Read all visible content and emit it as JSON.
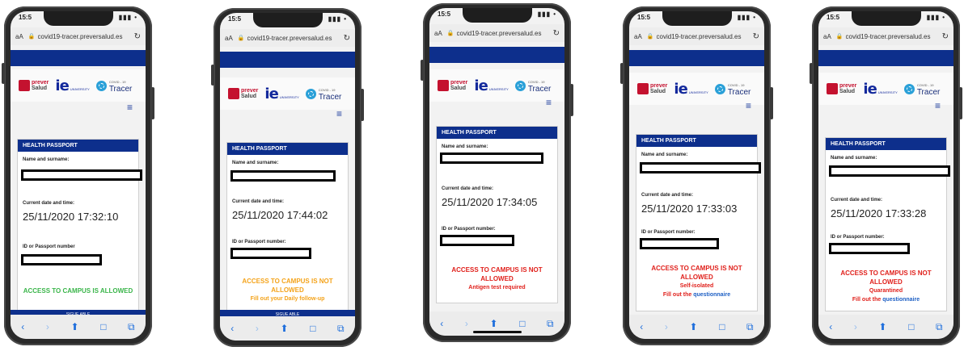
{
  "common": {
    "time_partial": "15:5",
    "signal": "▮▮▮ •",
    "aa_label": "aA",
    "lock": "🔒",
    "url": "covid19-tracer.preversalud.es",
    "reload": "↻",
    "prever_top": "prever",
    "prever_bottom": "Salud",
    "ie_text": "ie",
    "ie_univ": "UNIVERSITY",
    "tracer_small": "COVID - 19",
    "tracer_text": "Tracer",
    "menu_icon": "≡",
    "card_title": "HEALTH PASSPORT",
    "name_label": "Name and surname:",
    "date_label": "Current date and time:",
    "id_label_a": "ID or Passport number",
    "id_label_b": "ID or Passport number:",
    "footer_text": "SIGUE ABLE",
    "tb_back": "‹",
    "tb_fwd": "›",
    "tb_share": "⬆",
    "tb_book": "□",
    "tb_tabs": "⧉"
  },
  "phones": [
    {
      "datetime": "25/11/2020 17:32:10",
      "message_main": "ACCESS TO CAMPUS IS ALLOWED",
      "message_color": "#3ab54a"
    },
    {
      "datetime": "25/11/2020 17:44:02",
      "message_main": "ACCESS TO CAMPUS IS NOT ALLOWED",
      "message_sub": "Fill out your Daily follow-up",
      "message_color": "#f4a31a"
    },
    {
      "datetime": "25/11/2020 17:34:05",
      "message_main": "ACCESS TO CAMPUS IS NOT ALLOWED",
      "message_sub": "Antigen test required",
      "message_color": "#e0201b"
    },
    {
      "datetime": "25/11/2020 17:33:03",
      "message_main": "ACCESS TO CAMPUS IS NOT ALLOWED",
      "message_sub": "Self-isolated",
      "message_extra_prefix": "Fill out the ",
      "message_extra_link": "questionnaire",
      "message_color": "#e0201b"
    },
    {
      "datetime": "25/11/2020 17:33:28",
      "message_main": "ACCESS TO CAMPUS IS NOT ALLOWED",
      "message_sub": "Quarantined",
      "message_extra_prefix": "Fill out the ",
      "message_extra_link": "questionnaire",
      "message_color": "#e0201b"
    }
  ]
}
